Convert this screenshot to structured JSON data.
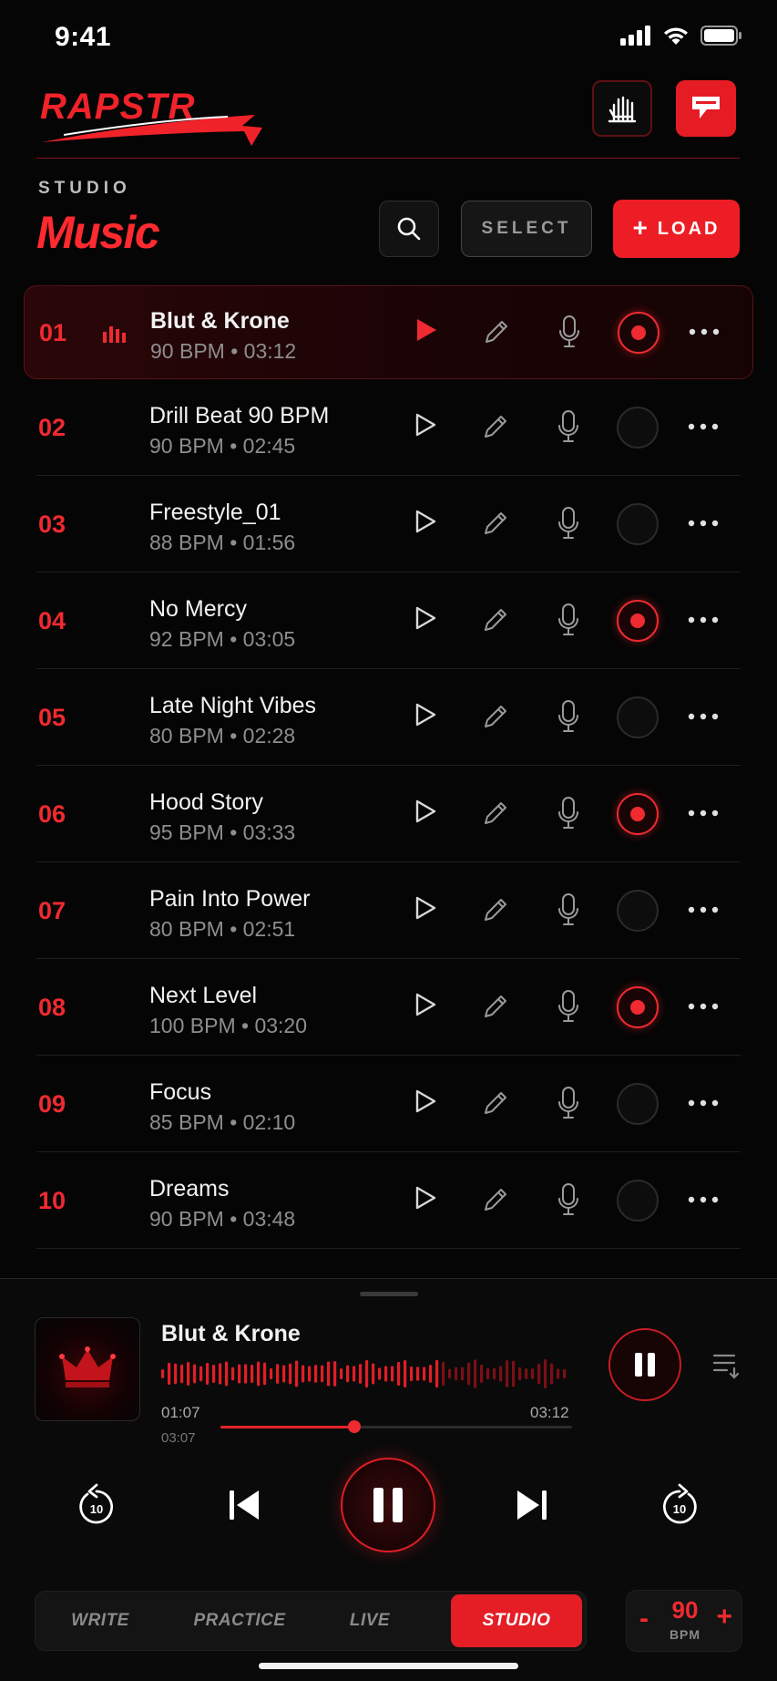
{
  "status_bar": {
    "time": "9:41"
  },
  "header": {
    "logo_text": "RAPSTR"
  },
  "toolbar": {
    "section_label": "STUDIO",
    "title": "Music",
    "select_label": "SELECT",
    "load_label": "LOAD"
  },
  "tracks": [
    {
      "num": "01",
      "name": "Blut & Krone",
      "meta": "90 BPM • 03:12",
      "recorded": true,
      "active": true
    },
    {
      "num": "02",
      "name": "Drill Beat 90 BPM",
      "meta": "90 BPM • 02:45",
      "recorded": false
    },
    {
      "num": "03",
      "name": "Freestyle_01",
      "meta": "88 BPM • 01:56",
      "recorded": false
    },
    {
      "num": "04",
      "name": "No Mercy",
      "meta": "92 BPM • 03:05",
      "recorded": true
    },
    {
      "num": "05",
      "name": "Late Night Vibes",
      "meta": "80 BPM • 02:28",
      "recorded": false
    },
    {
      "num": "06",
      "name": "Hood Story",
      "meta": "95 BPM • 03:33",
      "recorded": true
    },
    {
      "num": "07",
      "name": "Pain Into Power",
      "meta": "80 BPM • 02:51",
      "recorded": false
    },
    {
      "num": "08",
      "name": "Next Level",
      "meta": "100 BPM • 03:20",
      "recorded": true
    },
    {
      "num": "09",
      "name": "Focus",
      "meta": "85 BPM • 02:10",
      "recorded": false
    },
    {
      "num": "10",
      "name": "Dreams",
      "meta": "90 BPM • 03:48",
      "recorded": false
    }
  ],
  "player": {
    "title": "Blut & Krone",
    "elapsed": "01:07",
    "elapsed_sub": "03:07",
    "duration": "03:12",
    "progress": 0.38,
    "skip_back_seconds": "10",
    "skip_forward_seconds": "10"
  },
  "nav": {
    "tabs": [
      {
        "label": "WRITE"
      },
      {
        "label": "PRACTICE"
      },
      {
        "label": "LIVE"
      },
      {
        "label": "STUDIO",
        "active": true
      }
    ]
  },
  "bpm": {
    "minus": "-",
    "value": "90",
    "label": "BPM",
    "plus": "+"
  },
  "colors": {
    "accent": "#ef2a30",
    "background": "#050505"
  }
}
